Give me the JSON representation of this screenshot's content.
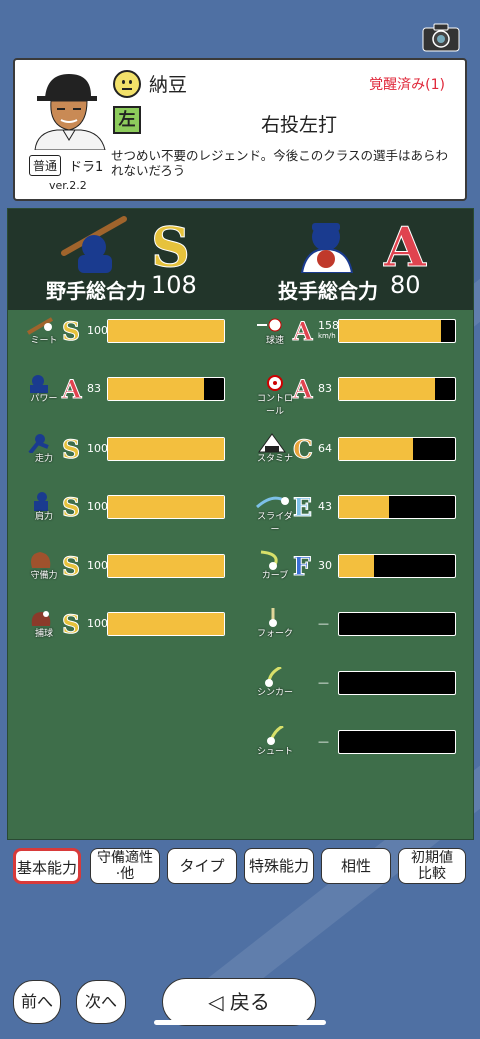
{
  "header": {
    "camera": "camera-icon"
  },
  "player": {
    "name": "納豆",
    "awakening": "覚醒済み(1)",
    "hand": "左",
    "bat_throw": "右投左打",
    "rarity": "普通",
    "draft": "ドラ1",
    "version": "ver.2.2",
    "description": "せつめい不要のレジェンド。今後このクラスの選手はあらわれないだろう",
    "mood": "neutral-face-icon"
  },
  "fielder": {
    "label": "野手総合力",
    "grade": "S",
    "value": "108"
  },
  "pitcher": {
    "label": "投手総合力",
    "grade": "A",
    "value": "80"
  },
  "batting_stats": [
    {
      "label": "ミート",
      "grade": "S",
      "value": "100",
      "fill": 1.0
    },
    {
      "label": "パワー",
      "grade": "A",
      "value": "83",
      "fill": 0.83
    },
    {
      "label": "走力",
      "grade": "S",
      "value": "100",
      "fill": 1.0
    },
    {
      "label": "肩力",
      "grade": "S",
      "value": "100",
      "fill": 1.0
    },
    {
      "label": "守備力",
      "grade": "S",
      "value": "100",
      "fill": 1.0
    },
    {
      "label": "捕球",
      "grade": "S",
      "value": "100",
      "fill": 1.0
    }
  ],
  "pitching_stats": [
    {
      "label": "球速",
      "grade": "A",
      "value": "158",
      "unit": "km/h",
      "fill": 0.88
    },
    {
      "label": "コントロール",
      "grade": "A",
      "value": "83",
      "fill": 0.83
    },
    {
      "label": "スタミナ",
      "grade": "C",
      "value": "64",
      "fill": 0.64
    },
    {
      "label": "スライダー",
      "grade": "E",
      "value": "43",
      "fill": 0.43
    },
    {
      "label": "カーブ",
      "grade": "F",
      "value": "30",
      "fill": 0.3
    },
    {
      "label": "フォーク",
      "grade": "",
      "value": "—",
      "fill": 0
    },
    {
      "label": "シンカー",
      "grade": "",
      "value": "—",
      "fill": 0
    },
    {
      "label": "シュート",
      "grade": "",
      "value": "—",
      "fill": 0
    }
  ],
  "tabs": [
    "基本能力",
    "守備適性\n·他",
    "タイプ",
    "特殊能力",
    "相性",
    "初期値\n比較"
  ],
  "nav": {
    "prev": "前へ",
    "next": "次へ",
    "back": "◁ 戻る"
  },
  "colors": {
    "S": "#e6c23c",
    "A": "#e0434f",
    "C": "#e8a23a",
    "E": "#7dc0e8",
    "F": "#3b6fd6",
    "bar_fill": "#f3bf3e"
  }
}
